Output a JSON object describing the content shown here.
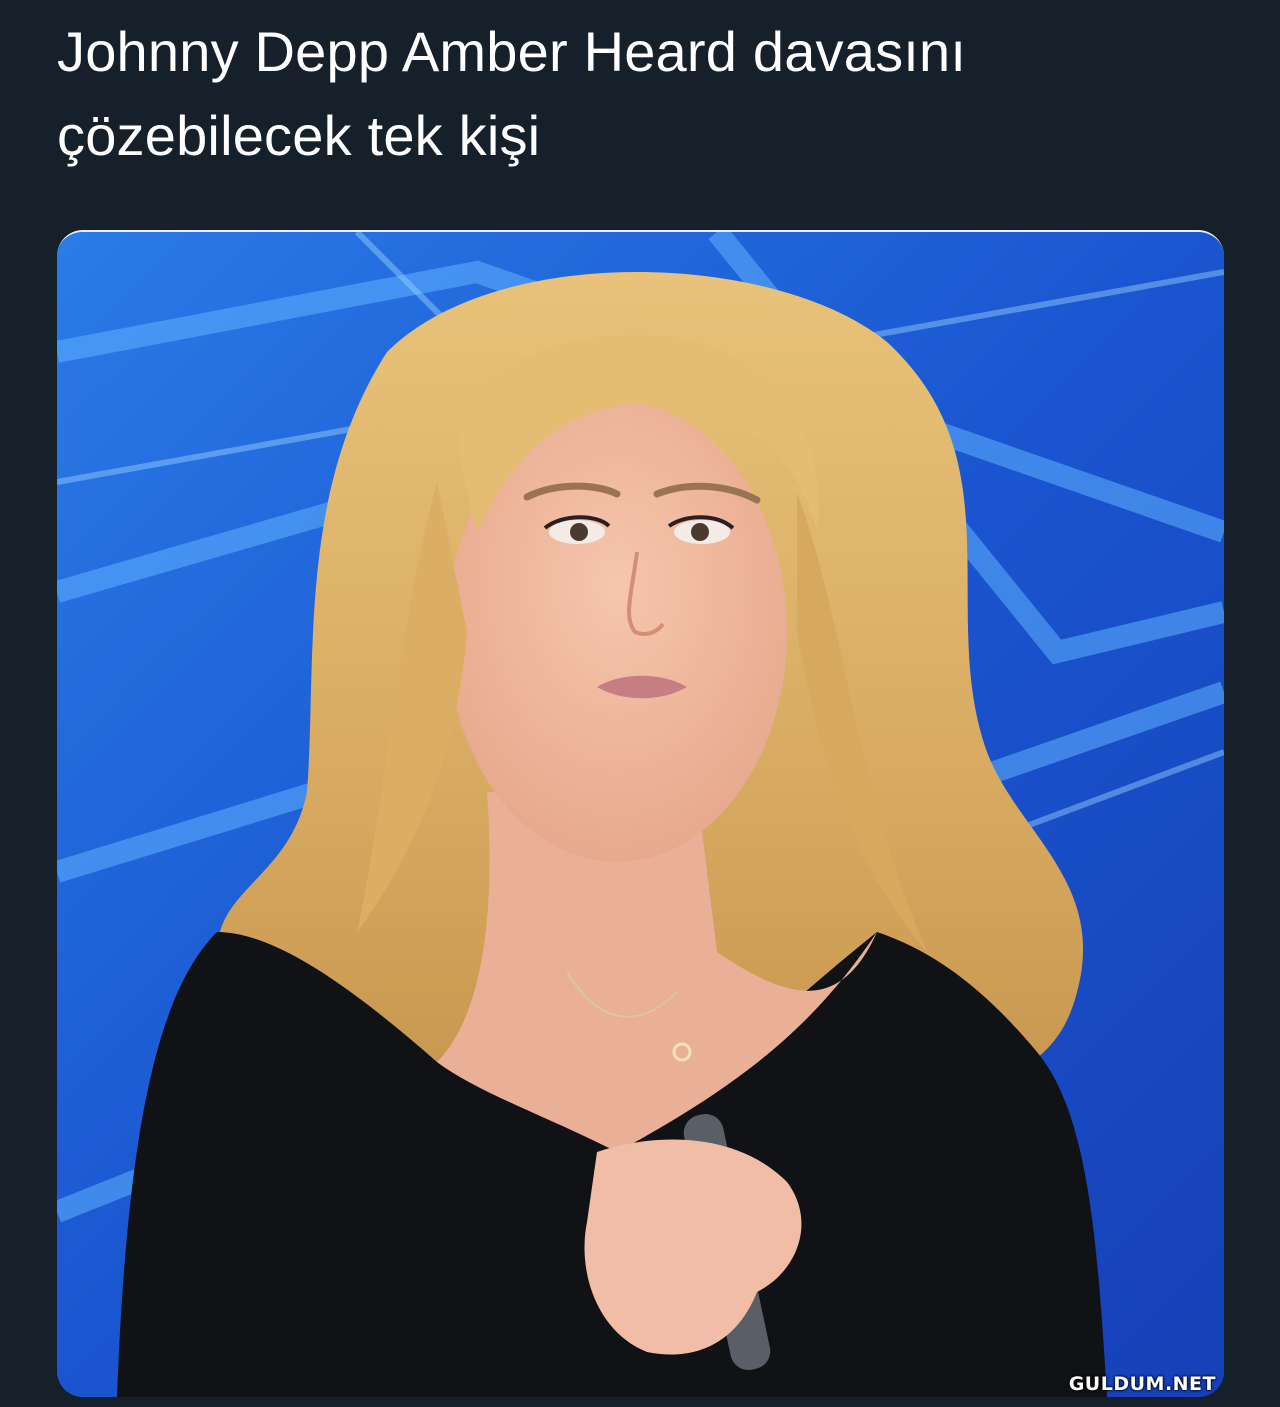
{
  "tweet": {
    "line1": "Johnny Depp Amber Heard davasını",
    "line2": "çözebilecek tek kişi"
  },
  "media": {
    "watermark": "GULDUM.NET"
  },
  "colors": {
    "background": "#15202b",
    "text": "#ffffff",
    "studio_blue": "#1f5fd8"
  }
}
